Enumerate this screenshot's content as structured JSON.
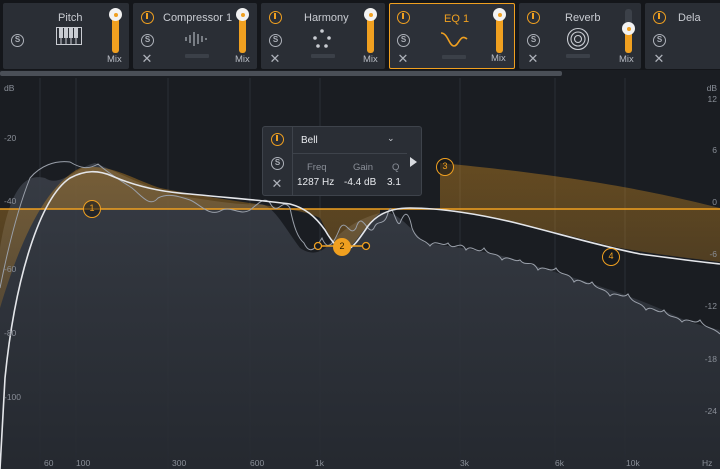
{
  "modules": [
    {
      "title": "Pitch",
      "mix_label": "Mix",
      "icon": "piano-icon"
    },
    {
      "title": "Compressor 1",
      "mix_label": "Mix",
      "icon": "waveform-icon"
    },
    {
      "title": "Harmony",
      "mix_label": "Mix",
      "icon": "dots-circle-icon"
    },
    {
      "title": "EQ 1",
      "mix_label": "Mix",
      "icon": "eq-curve-icon",
      "active": true
    },
    {
      "title": "Reverb",
      "mix_label": "Mix",
      "icon": "concentric-circles-icon"
    },
    {
      "title": "Dela",
      "mix_label": "",
      "icon": ""
    }
  ],
  "mix_levels": [
    1.0,
    1.0,
    1.0,
    1.0,
    0.65,
    null
  ],
  "eq": {
    "db_unit_left": "dB",
    "db_unit_right": "dB",
    "db_left": [
      "-20",
      "-40",
      "-60",
      "-80",
      "-100"
    ],
    "db_right": [
      "12",
      "6",
      "0",
      "-6",
      "-12",
      "-18",
      "-24"
    ],
    "freq_labels": [
      "60",
      "100",
      "300",
      "600",
      "1k",
      "3k",
      "6k",
      "10k",
      "Hz"
    ],
    "nodes": [
      "1",
      "2",
      "3",
      "4"
    ],
    "selected_node": "2"
  },
  "popup": {
    "type": "Bell",
    "freq_label": "Freq",
    "gain_label": "Gain",
    "q_label": "Q",
    "freq_value": "1287 Hz",
    "gain_value": "-4.4 dB",
    "q_value": "3.1"
  },
  "colors": {
    "accent": "#f0a020",
    "background": "#1a1d22",
    "panel": "#2a2e35",
    "spectrum": "#9aa0aa"
  }
}
